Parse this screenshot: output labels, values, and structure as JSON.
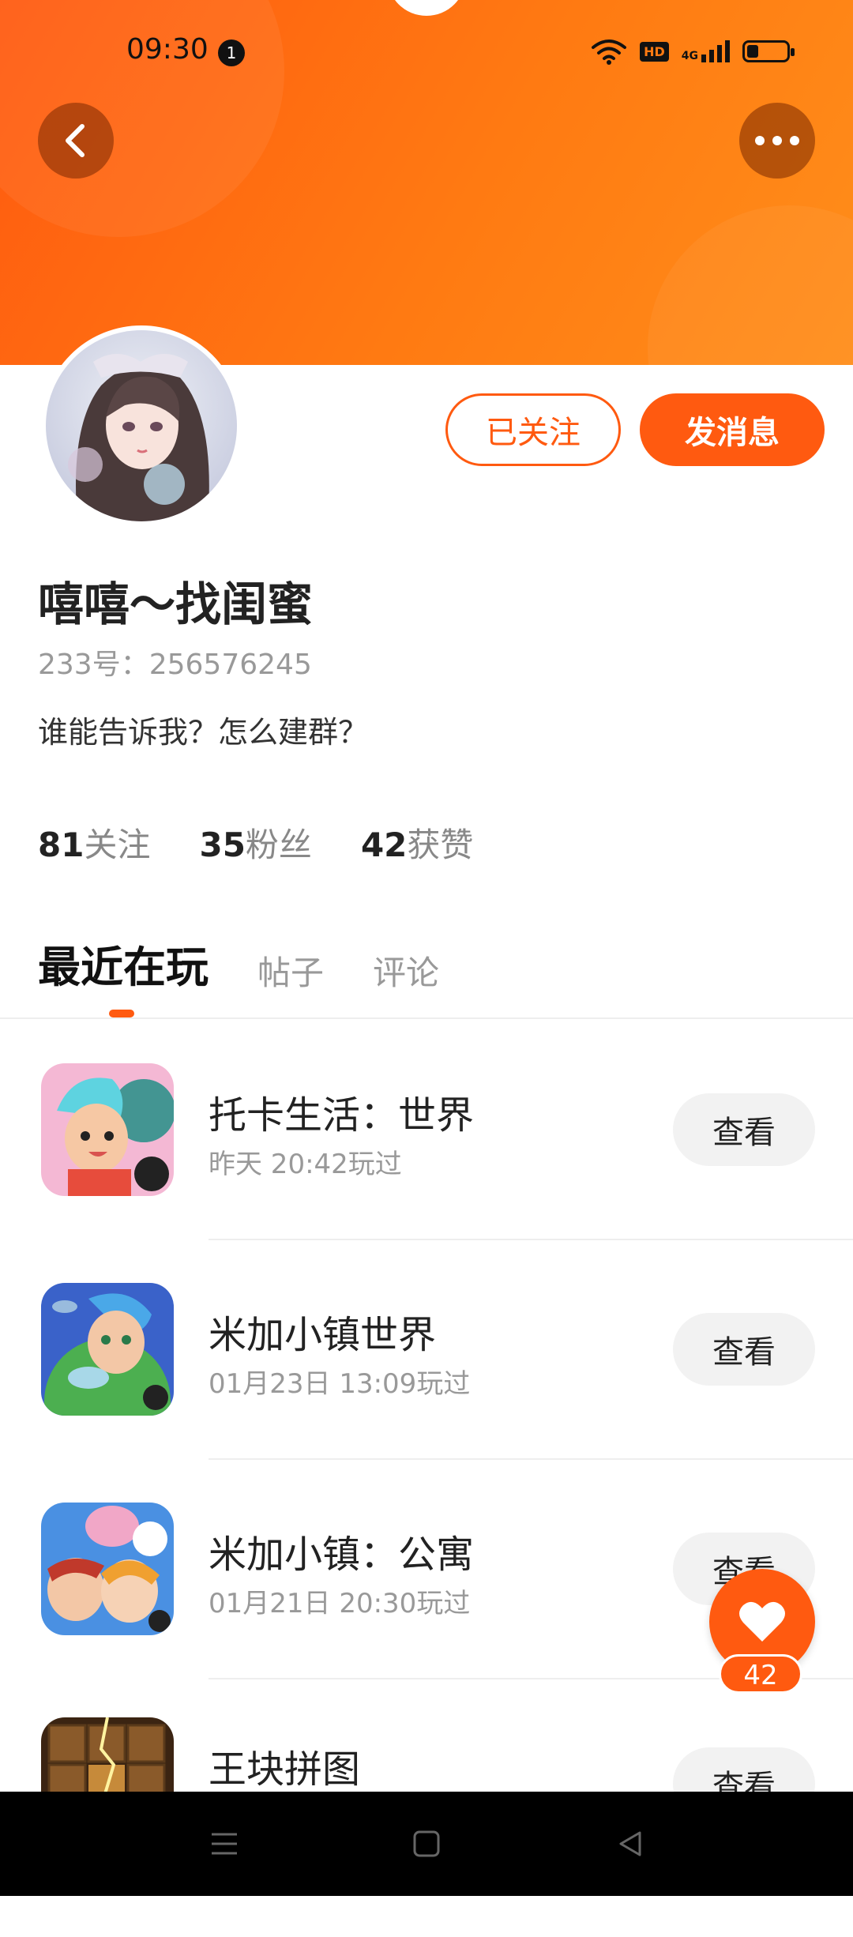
{
  "status_bar": {
    "time": "09:30",
    "notification_count": "1",
    "hd_label": "HD",
    "network_label": "4G"
  },
  "profile": {
    "follow_button": "已关注",
    "message_button": "发消息",
    "username": "嘻嘻～找闺蜜",
    "id_text": "233号：256576245",
    "bio": "谁能告诉我？怎么建群？",
    "stats": [
      {
        "num": "81",
        "label": "关注"
      },
      {
        "num": "35",
        "label": "粉丝"
      },
      {
        "num": "42",
        "label": "获赞"
      }
    ]
  },
  "tabs": [
    "最近在玩",
    "帖子",
    "评论"
  ],
  "games": [
    {
      "title": "托卡生活：世界",
      "sub": "昨天 20:42玩过",
      "action": "查看"
    },
    {
      "title": "米加小镇世界",
      "sub": "01月23日 13:09玩过",
      "action": "查看"
    },
    {
      "title": "米加小镇：公寓",
      "sub": "01月21日 20:30玩过",
      "action": "查看"
    },
    {
      "title": "王块拼图",
      "sub": "",
      "action": "查看"
    }
  ],
  "like_fab": {
    "count": "42"
  },
  "colors": {
    "accent": "#ff5a10",
    "banner_end": "#ff8e1a"
  }
}
